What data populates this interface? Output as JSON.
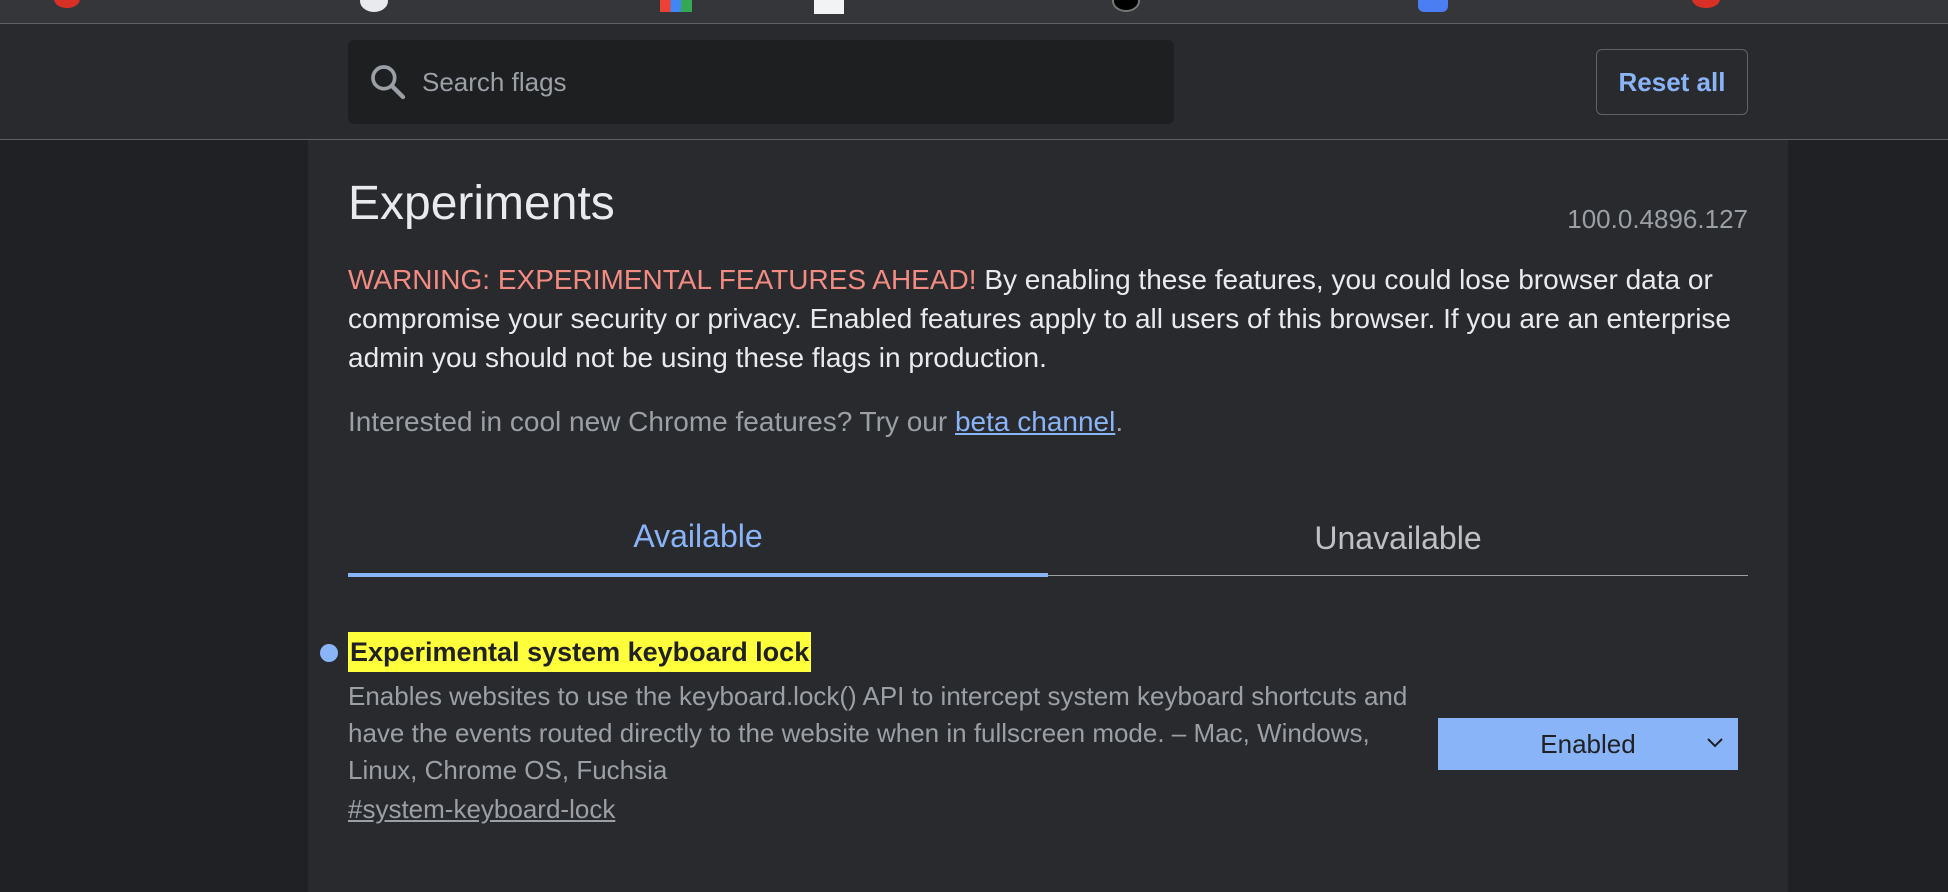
{
  "search": {
    "placeholder": "Search flags"
  },
  "header": {
    "reset_label": "Reset all"
  },
  "page": {
    "title": "Experiments",
    "version": "100.0.4896.127",
    "warning_head": "WARNING: EXPERIMENTAL FEATURES AHEAD!",
    "warning_body": " By enabling these features, you could lose browser data or compromise your security or privacy. Enabled features apply to all users of this browser. If you are an enterprise admin you should not be using these flags in production.",
    "interest_prefix": "Interested in cool new Chrome features? Try our ",
    "beta_link": "beta channel",
    "interest_suffix": "."
  },
  "tabs": [
    {
      "label": "Available",
      "active": true
    },
    {
      "label": "Unavailable",
      "active": false
    }
  ],
  "flags": [
    {
      "title": "Experimental system keyboard lock",
      "description": "Enables websites to use the keyboard.lock() API to intercept system keyboard shortcuts and have the events routed directly to the website when in fullscreen mode. – Mac, Windows, Linux, Chrome OS, Fuchsia",
      "anchor": "#system-keyboard-lock",
      "state": "Enabled"
    }
  ],
  "colors": {
    "accent": "#8ab4f8",
    "warning": "#f28b82",
    "highlight": "#ffff3b",
    "background": "#202124",
    "surface": "#292a2d"
  },
  "icons": {
    "search": "search-icon",
    "dropdown": "chevron-down-icon",
    "modified_indicator": "dot-icon"
  }
}
